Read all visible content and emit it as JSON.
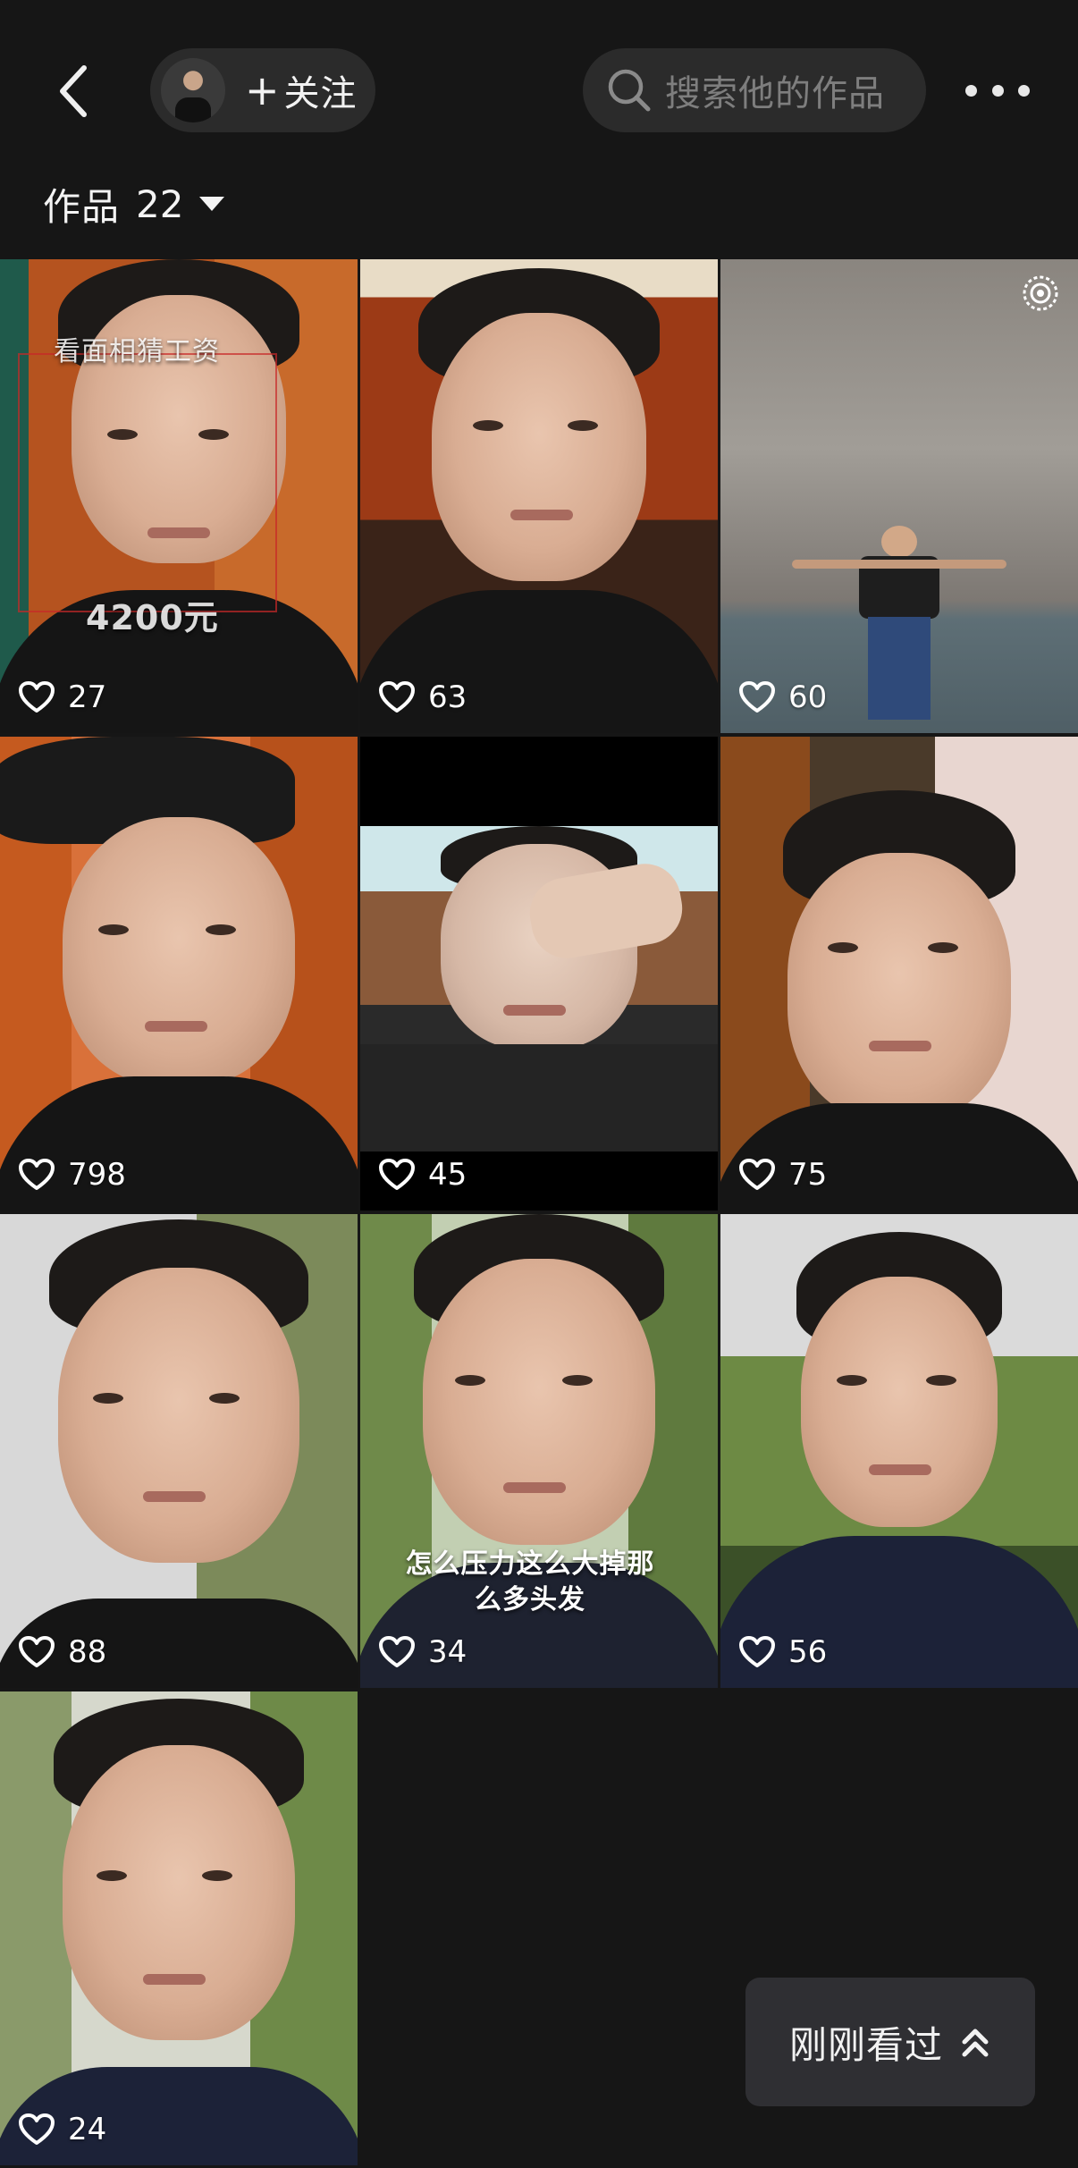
{
  "header": {
    "follow_label": "关注",
    "follow_plus": "+",
    "search_placeholder": "搜索他的作品"
  },
  "works": {
    "label": "作品",
    "count": "22"
  },
  "videos": [
    {
      "likes": "27",
      "top_text": "看面相猜工资",
      "bottom_text": "4200元"
    },
    {
      "likes": "63"
    },
    {
      "likes": "60"
    },
    {
      "likes": "798"
    },
    {
      "likes": "45"
    },
    {
      "likes": "75"
    },
    {
      "likes": "88"
    },
    {
      "likes": "34",
      "caption": "怎么压力这么大掉那么多头发"
    },
    {
      "likes": "56"
    },
    {
      "likes": "24"
    }
  ],
  "recent": {
    "label": "刚刚看过"
  },
  "colors": {
    "background": "#161616",
    "pill": "#2b2b2b",
    "recent_button": "#2f2f33"
  },
  "icons": [
    "back-arrow-icon",
    "search-icon",
    "more-dots-icon",
    "caret-down-icon",
    "heart-icon",
    "pin-icon",
    "double-chevron-up-icon"
  ]
}
